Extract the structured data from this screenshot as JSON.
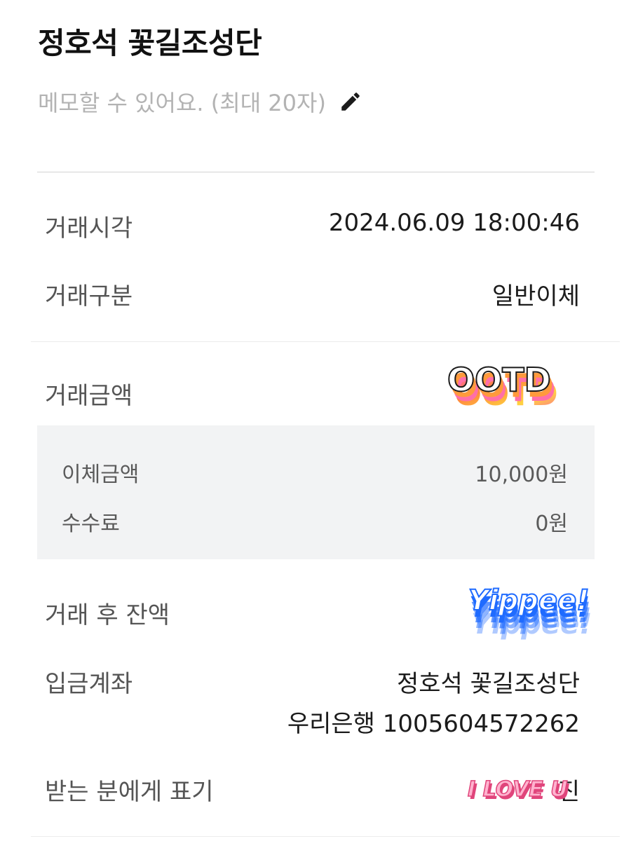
{
  "header": {
    "title": "정호석 꽃길조성단",
    "memo_placeholder": "메모할 수 있어요. (최대 20자)"
  },
  "details": {
    "time": {
      "label": "거래시각",
      "value": "2024.06.09 18:00:46"
    },
    "type": {
      "label": "거래구분",
      "value": "일반이체"
    },
    "amount": {
      "label": "거래금액"
    },
    "transfer_amount": {
      "label": "이체금액",
      "value": "10,000원"
    },
    "fee": {
      "label": "수수료",
      "value": "0원"
    },
    "balance_after": {
      "label": "거래 후 잔액"
    },
    "deposit_account": {
      "label": "입금계좌",
      "name": "정호석 꽃길조성단",
      "account": "우리은행 1005604572262"
    },
    "recipient_display": {
      "label": "받는 분에게 표기",
      "value_tail": "진"
    }
  },
  "stickers": {
    "ootd": "OOTD",
    "yippee": "Yippee!",
    "iloveu": "I LOVE U"
  },
  "colors": {
    "title": "#111111",
    "label": "#555555",
    "placeholder": "#b3b3b3",
    "box_bg": "#f2f3f4",
    "divider": "#d3d3d3"
  }
}
